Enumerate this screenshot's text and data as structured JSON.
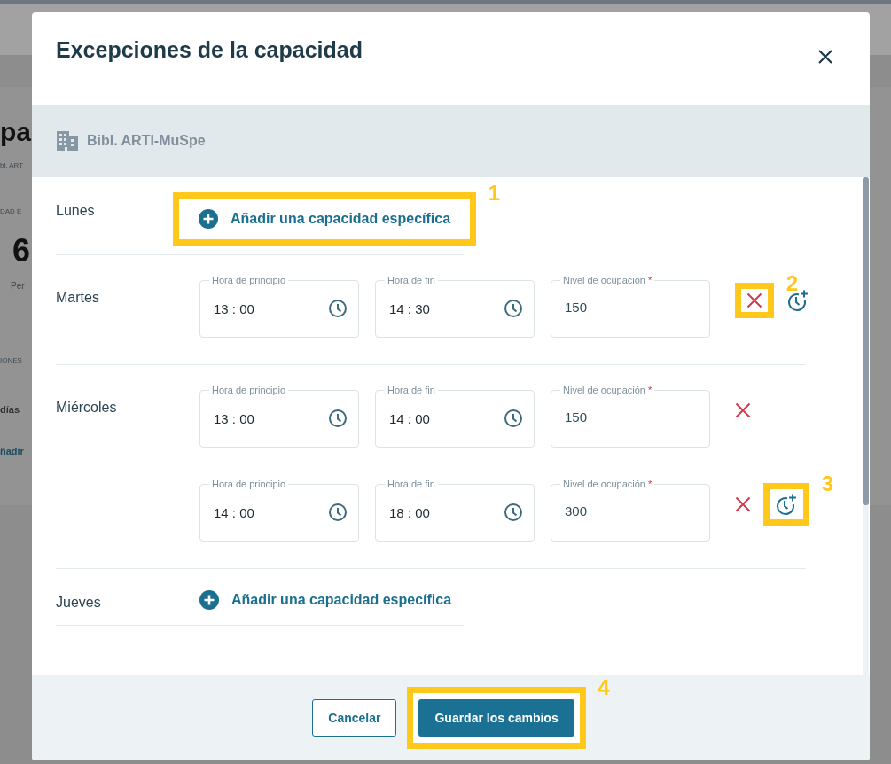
{
  "background_page": {
    "texts": [
      "pa",
      "bl. ART",
      "DAD E",
      "6",
      "Per",
      "IONES",
      "días",
      "ñadir"
    ]
  },
  "dialog": {
    "title": "Excepciones de la capacidad",
    "location": "Bibl. ARTI-MuSpe"
  },
  "days": [
    {
      "name": "Lunes",
      "kind": "empty",
      "add_label": "Añadir una capacidad específica",
      "callout": "1"
    },
    {
      "name": "Martes",
      "kind": "slots",
      "slots": [
        {
          "start_label": "Hora de principio",
          "start": "13 : 00",
          "end_label": "Hora de fin",
          "end": "14 : 30",
          "occupancy_label": "Nivel de ocupación",
          "required_mark": "*",
          "occupancy": "150",
          "delete_callout": "2",
          "add_time": true
        }
      ]
    },
    {
      "name": "Miércoles",
      "kind": "slots",
      "slots": [
        {
          "start_label": "Hora de principio",
          "start": "13 : 00",
          "end_label": "Hora de fin",
          "end": "14 : 00",
          "occupancy_label": "Nivel de ocupación",
          "required_mark": "*",
          "occupancy": "150",
          "add_time": false
        },
        {
          "start_label": "Hora de principio",
          "start": "14 : 00",
          "end_label": "Hora de fin",
          "end": "18 : 00",
          "occupancy_label": "Nivel de ocupación",
          "required_mark": "*",
          "occupancy": "300",
          "add_time": true,
          "add_time_callout": "3"
        }
      ]
    },
    {
      "name": "Jueves",
      "kind": "empty",
      "add_label": "Añadir una capacidad específica"
    }
  ],
  "buttons": {
    "cancel": "Cancelar",
    "save": "Guardar los cambios",
    "save_callout": "4"
  }
}
